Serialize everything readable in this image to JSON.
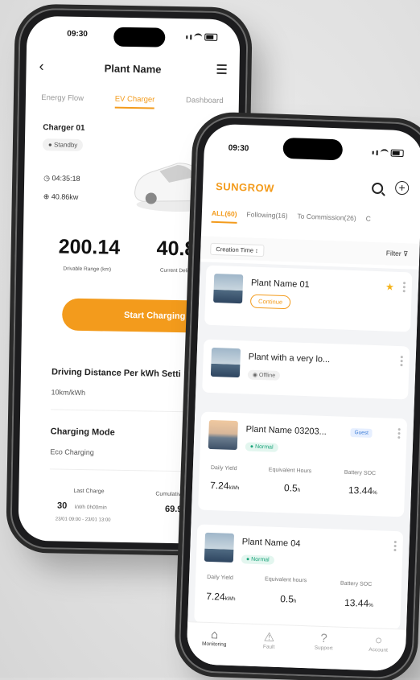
{
  "phone1": {
    "time": "09:30",
    "title": "Plant Name",
    "tabs": [
      "Energy Flow",
      "EV Charger",
      "Dashboard"
    ],
    "charger_name": "Charger 01",
    "status": "Standby",
    "duration": "04:35:18",
    "power": "40.86kw",
    "driving_range_value": "200.14",
    "driving_range_label": "Drivable Range (km)",
    "current_delivered_value": "40.8",
    "current_delivered_label": "Current Delivered (kwh)",
    "start_button": "Start Charging",
    "distance_setting_title": "Driving Distance Per kWh Setti",
    "distance_setting_value": "10km/kWh",
    "charging_mode_title": "Charging Mode",
    "charging_mode_value": "Eco Charging",
    "last_charge_label": "Last Charge",
    "last_charge_value": "30",
    "last_charge_detail": "kWh 0h00min",
    "last_charge_dates": "23/01 09:00 - 23/01 13:00",
    "cumulative_label": "Cumulative",
    "cumulative_value": "69.9"
  },
  "phone2": {
    "time": "09:30",
    "brand": "SUNGROW",
    "tabs": [
      "ALL(60)",
      "Following(16)",
      "To Commission(26)",
      "C"
    ],
    "sort_label": "Creation Time ↕",
    "filter_label": "Filter",
    "plants": [
      {
        "name": "Plant Name 01",
        "action": "Continue"
      },
      {
        "name": "Plant with a very lo...",
        "status": "Offline"
      },
      {
        "name": "Plant Name 03203...",
        "badge": "Guest",
        "status": "Normal",
        "m1_label": "Daily Yield",
        "m1_value": "7.24",
        "m1_unit": "kWh",
        "m2_label": "Equivalent Hours",
        "m2_value": "0.5",
        "m2_unit": "h",
        "m3_label": "Battery SOC",
        "m3_value": "13.44",
        "m3_unit": "%"
      },
      {
        "name": "Plant Name 04",
        "status": "Normal",
        "m1_label": "Daily Yield",
        "m1_value": "7.24",
        "m1_unit": "kWh",
        "m2_label": "Equivalent hours",
        "m2_value": "0.5",
        "m2_unit": "h",
        "m3_label": "Battery SOC",
        "m3_value": "13.44",
        "m3_unit": "%"
      }
    ],
    "nav": [
      "Monitoring",
      "Fault",
      "Support",
      "Account"
    ]
  },
  "colors": {
    "accent": "#f39b1c",
    "normal": "#1aa37a",
    "guest": "#3a7bd5"
  },
  "icons": [
    "back-icon",
    "menu-icon",
    "search-icon",
    "add-icon",
    "star-icon",
    "filter-icon",
    "home-icon",
    "warning-icon",
    "help-icon",
    "account-icon"
  ]
}
